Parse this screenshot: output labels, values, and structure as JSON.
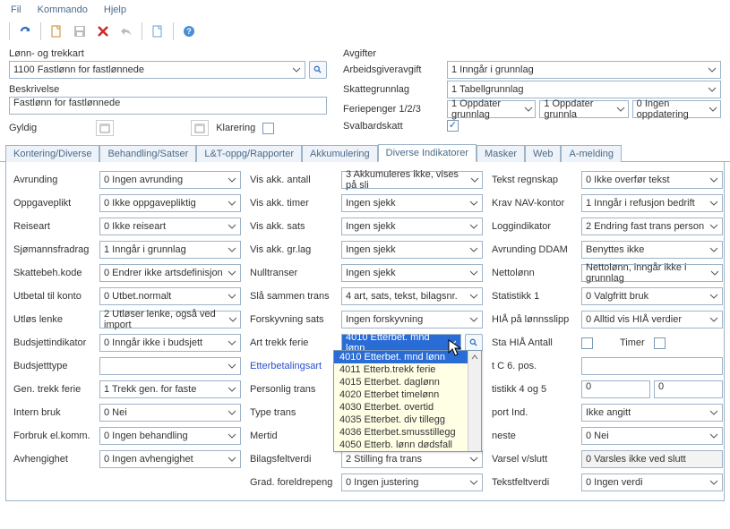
{
  "menu": {
    "fil": "Fil",
    "kommando": "Kommando",
    "hjelp": "Hjelp"
  },
  "upper": {
    "lonn_label": "Lønn- og trekkart",
    "lonn_value": "1100 Fastlønn for fastlønnede",
    "beskr_label": "Beskrivelse",
    "beskr_value": "Fastlønn for fastlønnede",
    "gyldig_label": "Gyldig",
    "klarering_label": "Klarering"
  },
  "avgifter": {
    "title": "Avgifter",
    "arbeidsgiver_lbl": "Arbeidsgiveravgift",
    "arbeidsgiver_val": "1 Inngår i grunnlag",
    "skatte_lbl": "Skattegrunnlag",
    "skatte_val": "1 Tabellgrunnlag",
    "ferie_lbl": "Feriepenger 1/2/3",
    "ferie_v1": "1 Oppdater grunnlag",
    "ferie_v2": "1 Oppdater grunnla",
    "ferie_v3": "0 Ingen oppdatering",
    "svalbard_lbl": "Svalbardskatt"
  },
  "tabs": {
    "t1": "Kontering/Diverse",
    "t2": "Behandling/Satser",
    "t3": "L&T-oppg/Rapporter",
    "t4": "Akkumulering",
    "t5": "Diverse Indikatorer",
    "t6": "Masker",
    "t7": "Web",
    "t8": "A-melding"
  },
  "grid": {
    "c1": {
      "avrunding_l": "Avrunding",
      "avrunding_v": "0 Ingen avrunding",
      "oppgaveplikt_l": "Oppgaveplikt",
      "oppgaveplikt_v": "0 Ikke oppgavepliktig",
      "reiseart_l": "Reiseart",
      "reiseart_v": "0 Ikke reiseart",
      "sjomann_l": "Sjømannsfradrag",
      "sjomann_v": "1 Inngår i grunnlag",
      "skattebeh_l": "Skattebeh.kode",
      "skattebeh_v": "0 Endrer ikke artsdefinisjon",
      "utbetal_l": "Utbetal til konto",
      "utbetal_v": "0 Utbet.normalt",
      "utlos_l": "Utløs lenke",
      "utlos_v": "2 Utløser lenke, også ved import",
      "budsjettind_l": "Budsjettindikator",
      "budsjettind_v": "0 Inngår ikke i budsjett",
      "budsjetttype_l": "Budsjetttype",
      "budsjetttype_v": "",
      "gentrekk_l": "Gen. trekk ferie",
      "gentrekk_v": "1 Trekk gen. for faste",
      "intern_l": "Intern bruk",
      "intern_v": "0 Nei",
      "forbruk_l": "Forbruk el.komm.",
      "forbruk_v": "0 Ingen behandling",
      "avheng_l": "Avhengighet",
      "avheng_v": "0 Ingen avhengighet"
    },
    "c2": {
      "visantall_l": "Vis akk. antall",
      "visantall_v": "3 Akkumuleres ikke, vises på sli",
      "vistimer_l": "Vis akk. timer",
      "vistimer_v": "Ingen sjekk",
      "vissats_l": "Vis akk. sats",
      "vissats_v": "Ingen sjekk",
      "visgrlag_l": "Vis akk. gr.lag",
      "visgrlag_v": "Ingen sjekk",
      "nulltrans_l": "Nulltranser",
      "nulltrans_v": "Ingen sjekk",
      "slasammen_l": "Slå sammen trans",
      "slasammen_v": "4 art, sats, tekst, bilagsnr.",
      "forskyv_l": "Forskyvning sats",
      "forskyv_v": "Ingen forskyvning",
      "arttrekk_l": "Art trekk ferie",
      "arttrekk_v": "4010 Etterbet. mnd lønn",
      "etterbet_l": "Etterbetalingsart",
      "personlig_l": "Personlig trans",
      "typetrans_l": "Type trans",
      "mertid_l": "Mertid",
      "bilagsfelt_l": "Bilagsfeltverdi",
      "bilagsfelt_v": "2 Stilling fra trans",
      "gradforeldr_l": "Grad. foreldrepeng",
      "gradforeldr_v": "0 Ingen justering"
    },
    "c3": {
      "tekstreg_l": "Tekst regnskap",
      "tekstreg_v": "0 Ikke overfør tekst",
      "kravnav_l": "Krav NAV-kontor",
      "kravnav_v": "1 Inngår i refusjon bedrift",
      "loggind_l": "Loggindikator",
      "loggind_v": "2 Endring fast trans person",
      "avrundddam_l": "Avrunding DDAM",
      "avrundddam_v": "Benyttes ikke",
      "nettolonn_l": "Nettolønn",
      "nettolonn_v": "Nettolønn, inngår ikke i grunnlag",
      "stat1_l": "Statistikk 1",
      "stat1_v": "0 Valgfritt bruk",
      "hia_l": "HIÅ på lønnsslipp",
      "hia_v": "0 Alltid vis HIÅ verdier",
      "stahia_l": "Sta HIÅ Antall",
      "timer_l": "Timer",
      "c6_l": "t C 6. pos.",
      "stat45_l": "tistikk 4 og 5",
      "stat45_v1": "0",
      "stat45_v2": "0",
      "portind_l": "port Ind.",
      "portind_v": "Ikke angitt",
      "neste_l": "neste",
      "neste_v": "0 Nei",
      "varsel_l": "Varsel v/slutt",
      "varsel_v": "0 Varsles ikke ved slutt",
      "tekstfelt_l": "Tekstfeltverdi",
      "tekstfelt_v": "0 Ingen verdi"
    }
  },
  "dropdown": {
    "o1": "4010 Etterbet. mnd lønn",
    "o2": "4011 Etterb.trekk ferie",
    "o3": "4015 Etterbet. daglønn",
    "o4": "4020 Etterbet timelønn",
    "o5": "4030 Etterbet. overtid",
    "o6": "4035 Etterbet. div tillegg",
    "o7": "4036 Etterbet.smusstillegg",
    "o8": "4050 Etterb. lønn dødsfall"
  }
}
